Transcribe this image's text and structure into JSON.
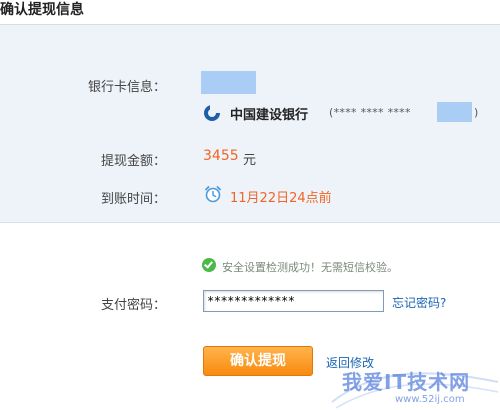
{
  "page": {
    "title": "确认提现信息"
  },
  "info": {
    "card_label": "银行卡信息：",
    "bank_name": "中国建设银行",
    "card_number_masked": "(**** **** ****",
    "card_number_close": ")",
    "amount_label": "提现金额：",
    "amount_value": "3455",
    "amount_unit": "元",
    "arrival_label": "到账时间：",
    "arrival_value": "11月22日24点前"
  },
  "security": {
    "message": "安全设置检测成功！无需短信校验。"
  },
  "password": {
    "label": "支付密码：",
    "value": "*************",
    "forgot_label": "忘记密码?"
  },
  "actions": {
    "confirm_label": "确认提现",
    "back_label": "返回修改"
  },
  "watermark": {
    "text": "我爱IT技术网",
    "url": "www.52ij.com"
  },
  "colors": {
    "accent_orange": "#f06522",
    "link_blue": "#1a64b4",
    "panel_bg": "#eef3f9",
    "success_green": "#4cb848",
    "button_orange": "#f88a11"
  },
  "icons": {
    "bank": "ccb-bank-logo-icon",
    "arrival": "alarm-clock-icon",
    "security": "check-circle-icon"
  }
}
